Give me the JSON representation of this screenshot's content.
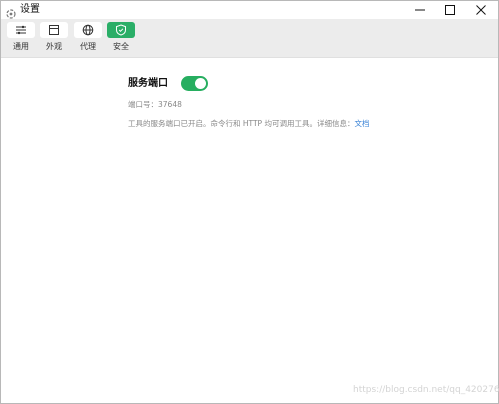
{
  "window": {
    "title": "设置"
  },
  "toolbar": {
    "items": [
      {
        "label": "通用",
        "icon": "sliders-icon",
        "active": false
      },
      {
        "label": "外观",
        "icon": "window-icon",
        "active": false
      },
      {
        "label": "代理",
        "icon": "globe-icon",
        "active": false
      },
      {
        "label": "安全",
        "icon": "shield-icon",
        "active": true
      }
    ]
  },
  "security": {
    "service_port_title": "服务端口",
    "service_port_enabled": true,
    "port_line": "端口号：37648",
    "description": "工具的服务端口已开启。命令行和 HTTP 均可调用工具。详细信息：",
    "doc_link": "文档"
  },
  "watermark": "https://blog.csdn.net/qq_42027681",
  "colors": {
    "accent": "#27ae60",
    "link": "#3a83d6",
    "toolbar_bg": "#ececec"
  }
}
